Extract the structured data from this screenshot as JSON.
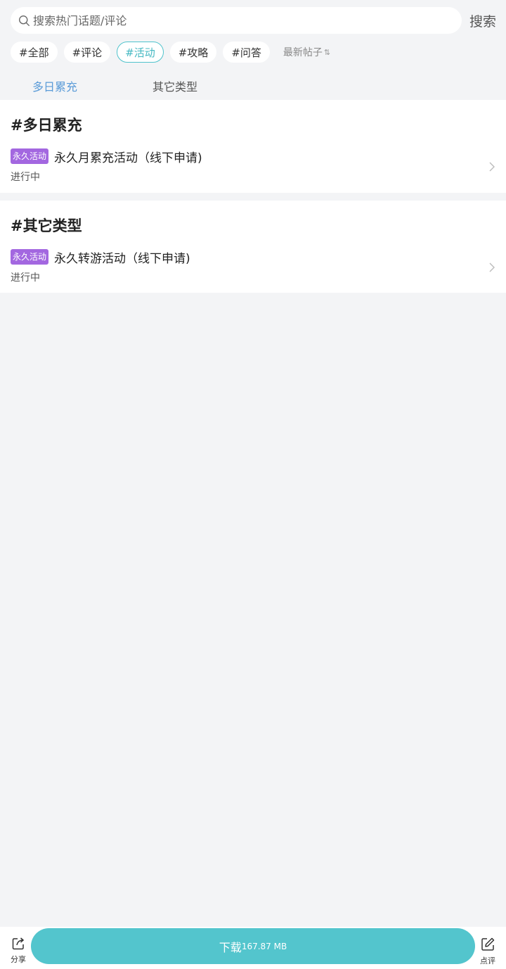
{
  "search": {
    "placeholder": "搜索热门话题/评论",
    "button_label": "搜索"
  },
  "tags": [
    {
      "label": "#全部",
      "active": false
    },
    {
      "label": "#评论",
      "active": false
    },
    {
      "label": "#活动",
      "active": true
    },
    {
      "label": "#攻略",
      "active": false
    },
    {
      "label": "#问答",
      "active": false
    }
  ],
  "sort": {
    "label": "最新帖子",
    "icon": "sort-arrows-icon"
  },
  "category_tabs": [
    {
      "label": "多日累充",
      "active": true
    },
    {
      "label": "其它类型",
      "active": false
    }
  ],
  "sections": [
    {
      "title": "#多日累充",
      "items": [
        {
          "badge": "永久活动",
          "title": "永久月累充活动（线下申请)",
          "status": "进行中"
        }
      ]
    },
    {
      "title": "#其它类型",
      "items": [
        {
          "badge": "永久活动",
          "title": "永久转游活动（线下申请)",
          "status": "进行中"
        }
      ]
    }
  ],
  "bottom_bar": {
    "share_label": "分享",
    "download_label": "下载",
    "download_size": "167.87 MB",
    "review_label": "点评"
  },
  "colors": {
    "accent": "#53c5cd",
    "badge": "#a367e0",
    "tab_active": "#5a9bd8"
  }
}
